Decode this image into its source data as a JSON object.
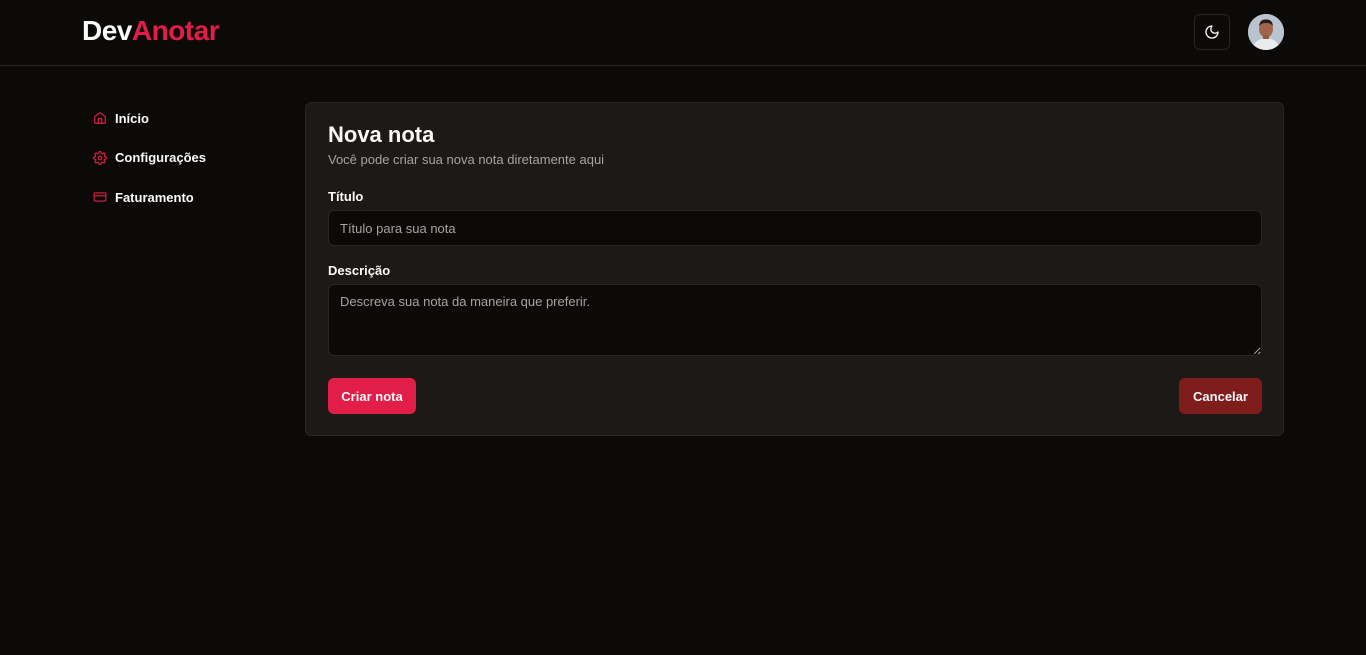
{
  "app": {
    "logo_part1": "Dev",
    "logo_part2": "Anotar"
  },
  "header": {
    "theme_toggle_icon": "moon-icon",
    "avatar_icon": "user-avatar"
  },
  "sidebar": {
    "items": [
      {
        "label": "Início",
        "icon": "home-icon"
      },
      {
        "label": "Configurações",
        "icon": "gear-icon"
      },
      {
        "label": "Faturamento",
        "icon": "credit-card-icon"
      }
    ]
  },
  "form": {
    "title": "Nova nota",
    "subtitle": "Você pode criar sua nova nota diretamente aqui",
    "title_label": "Título",
    "title_value": "",
    "title_placeholder": "Título para sua nota",
    "description_label": "Descrição",
    "description_value": "",
    "description_placeholder": "Descreva sua nota da maneira que preferir.",
    "submit_label": "Criar nota",
    "cancel_label": "Cancelar"
  },
  "colors": {
    "background": "#0c0a09",
    "card": "#1c1917",
    "border": "#292524",
    "accent": "#e11d48",
    "cancel": "#7f1d1d",
    "muted_text": "#a8a29e"
  }
}
